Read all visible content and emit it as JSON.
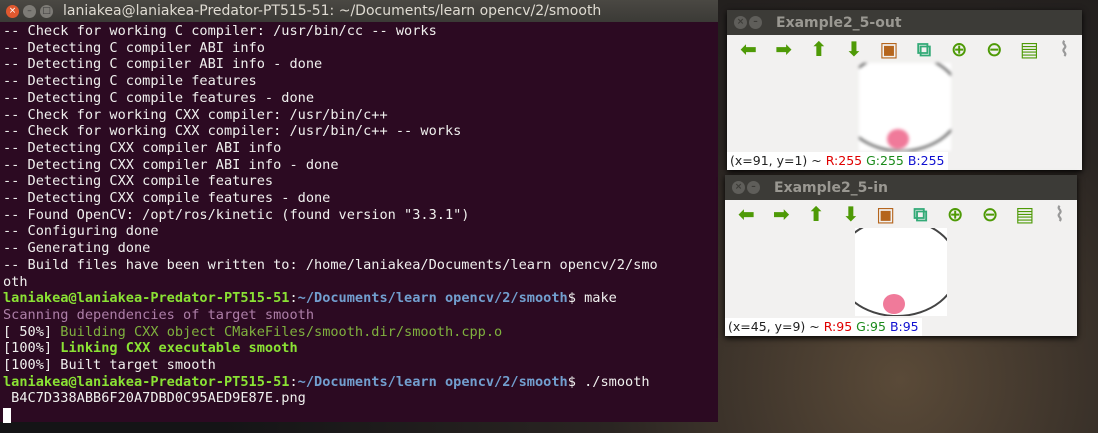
{
  "terminal": {
    "title": "laniakea@laniakea-Predator-PT515-51: ~/Documents/learn opencv/2/smooth",
    "lines": [
      "-- Check for working C compiler: /usr/bin/cc -- works",
      "-- Detecting C compiler ABI info",
      "-- Detecting C compiler ABI info - done",
      "-- Detecting C compile features",
      "-- Detecting C compile features - done",
      "-- Check for working CXX compiler: /usr/bin/c++",
      "-- Check for working CXX compiler: /usr/bin/c++ -- works",
      "-- Detecting CXX compiler ABI info",
      "-- Detecting CXX compiler ABI info - done",
      "-- Detecting CXX compile features",
      "-- Detecting CXX compile features - done",
      "-- Found OpenCV: /opt/ros/kinetic (found version \"3.3.1\")",
      "-- Configuring done",
      "-- Generating done",
      "-- Build files have been written to: /home/laniakea/Documents/learn opencv/2/smo",
      "oth"
    ],
    "prompt_user": "laniakea@laniakea-Predator-PT515-51",
    "prompt_path": "~/Documents/learn opencv/2/smooth",
    "cmd1": "$ make",
    "scan": "Scanning dependencies of target smooth",
    "build_pct": "[ 50%] ",
    "build_msg": "Building CXX object CMakeFiles/smooth.dir/smooth.cpp.o",
    "link_pct": "[100%] ",
    "link_msg": "Linking CXX executable smooth",
    "built": "[100%] Built target smooth",
    "cmd2": "$ ./smooth",
    "output": " B4C7D338ABB6F20A7DBD0C95AED9E87E.png"
  },
  "windows": [
    {
      "title": "Example2_5-out",
      "coords": "(x=91, y=1) ~ ",
      "r": "R:255",
      "g": "G:255",
      "b": "B:255"
    },
    {
      "title": "Example2_5-in",
      "coords": "(x=45, y=9) ~ ",
      "r": "R:95",
      "g": "G:95",
      "b": "B:95"
    }
  ]
}
